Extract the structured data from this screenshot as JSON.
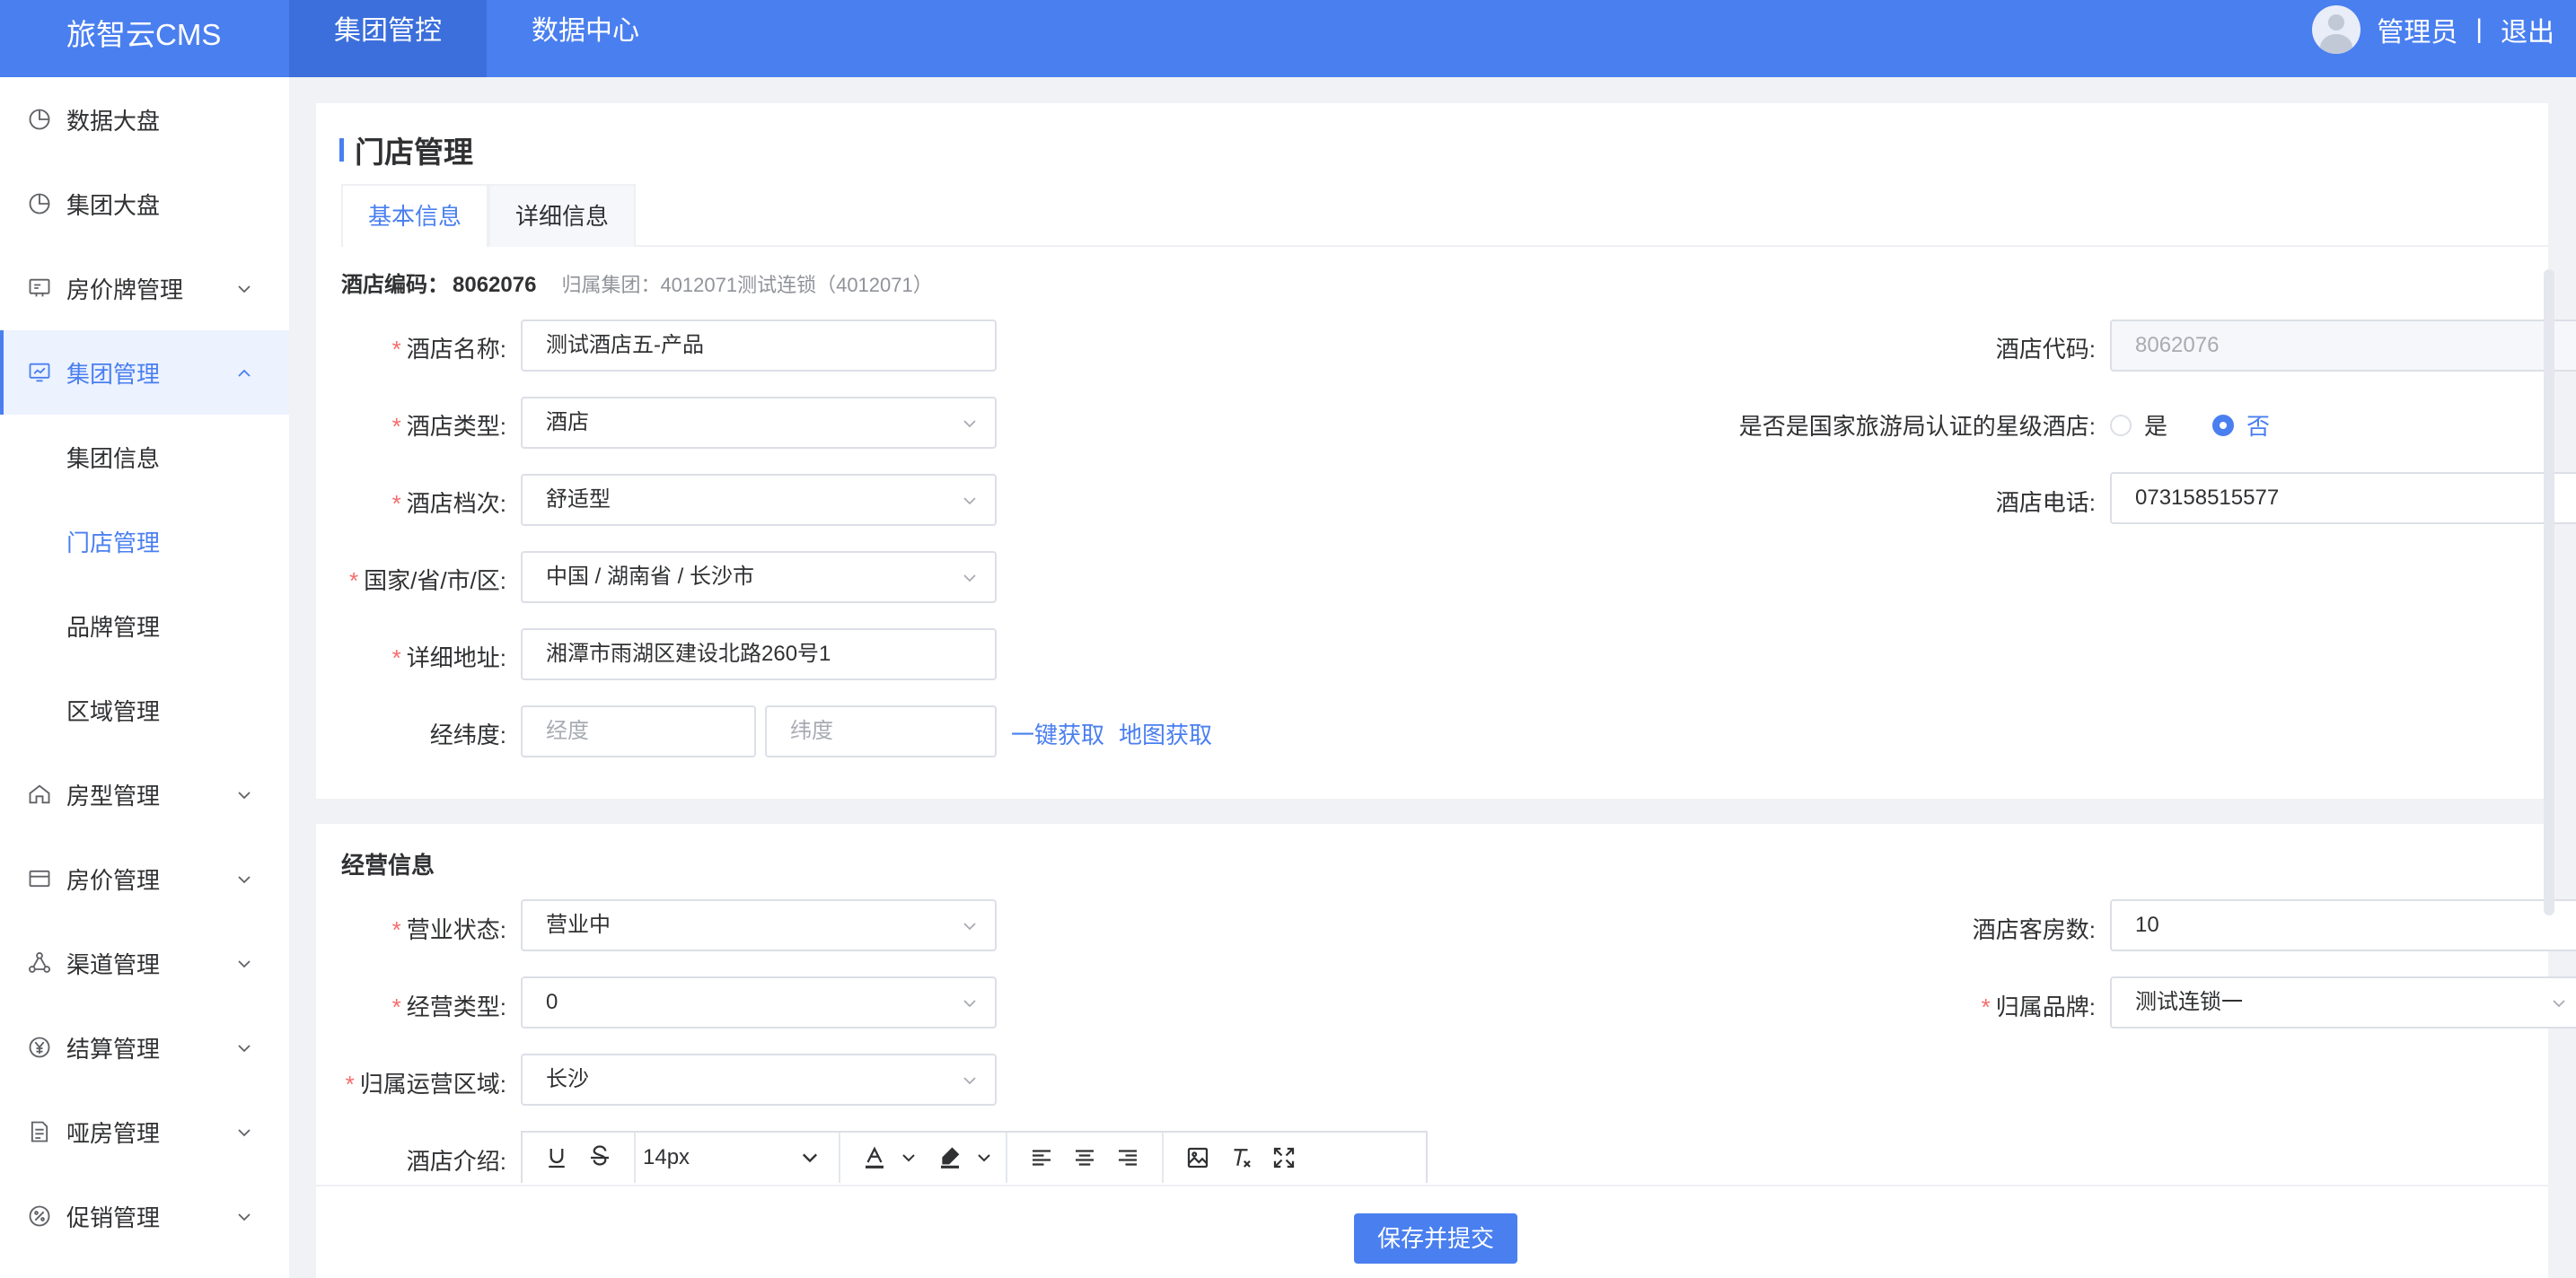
{
  "app": {
    "brand": "旅智云CMS"
  },
  "topnav": [
    {
      "label": "集团管控",
      "active": true
    },
    {
      "label": "数据中心",
      "active": false
    }
  ],
  "user": {
    "name": "管理员",
    "separator": "|",
    "logout": "退出"
  },
  "sidebar": {
    "items": [
      {
        "label": "数据大盘",
        "icon": "pie-chart-icon"
      },
      {
        "label": "集团大盘",
        "icon": "pie-chart-icon"
      },
      {
        "label": "房价牌管理",
        "icon": "price-board-icon"
      },
      {
        "label": "集团管理",
        "icon": "monitor-icon"
      },
      {
        "label": "集团信息"
      },
      {
        "label": "门店管理"
      },
      {
        "label": "品牌管理"
      },
      {
        "label": "区域管理"
      },
      {
        "label": "房型管理",
        "icon": "home-icon"
      },
      {
        "label": "房价管理",
        "icon": "card-icon"
      },
      {
        "label": "渠道管理",
        "icon": "share-icon"
      },
      {
        "label": "结算管理",
        "icon": "yen-icon"
      },
      {
        "label": "哑房管理",
        "icon": "document-icon"
      },
      {
        "label": "促销管理",
        "icon": "discount-icon"
      }
    ]
  },
  "page": {
    "title": "门店管理",
    "tabs": [
      {
        "label": "基本信息",
        "active": true
      },
      {
        "label": "详细信息",
        "active": false
      }
    ],
    "code_label": "酒店编码：",
    "code_value": "8062076",
    "group_info": "归属集团：4012071测试连锁（4012071）"
  },
  "form": {
    "hotel_name": {
      "label": "酒店名称:",
      "value": "测试酒店五-产品"
    },
    "hotel_code": {
      "label": "酒店代码:",
      "value": "8062076"
    },
    "hotel_type": {
      "label": "酒店类型:",
      "value": "酒店"
    },
    "star_certified": {
      "label": "是否是国家旅游局认证的星级酒店:",
      "yes": "是",
      "no": "否",
      "selected": "否"
    },
    "hotel_grade": {
      "label": "酒店档次:",
      "value": "舒适型"
    },
    "hotel_phone": {
      "label": "酒店电话:",
      "value": "073158515577"
    },
    "region": {
      "label": "国家/省/市/区:",
      "value": "中国 / 湖南省 / 长沙市"
    },
    "address": {
      "label": "详细地址:",
      "value": "湘潭市雨湖区建设北路260号1"
    },
    "coords": {
      "label": "经纬度:",
      "lng_placeholder": "经度",
      "lat_placeholder": "纬度",
      "auto_fetch": "一键获取",
      "map_fetch": "地图获取"
    }
  },
  "business": {
    "title": "经营信息",
    "status": {
      "label": "营业状态:",
      "value": "营业中"
    },
    "room_count": {
      "label": "酒店客房数:",
      "value": "10"
    },
    "business_type": {
      "label": "经营类型:",
      "value": "0"
    },
    "brand": {
      "label": "归属品牌:",
      "value": "测试连锁一"
    },
    "operation_region": {
      "label": "归属运营区域:",
      "value": "长沙"
    },
    "intro": {
      "label": "酒店介绍:",
      "font_size": "14px"
    }
  },
  "footer": {
    "submit": "保存并提交"
  },
  "colors": {
    "primary": "#4a7ff0",
    "required": "#f56c6c",
    "border": "#dcdfe6"
  }
}
